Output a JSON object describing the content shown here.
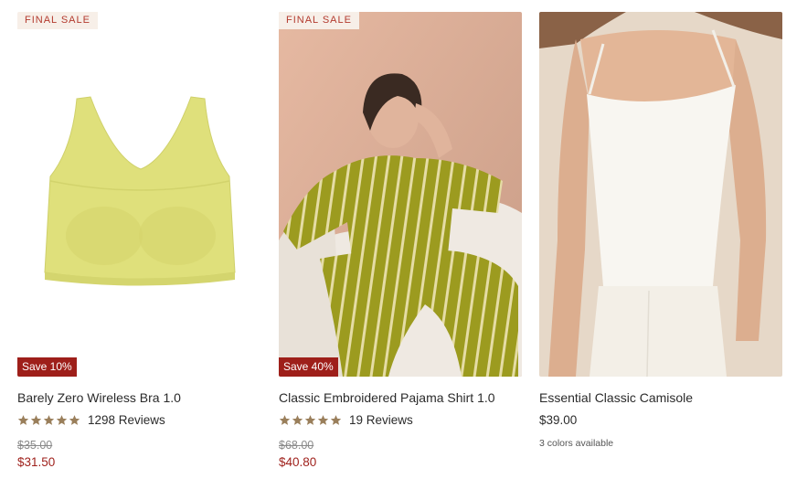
{
  "products": [
    {
      "badge_top": "FINAL SALE",
      "badge_save": "Save 10%",
      "title": "Barely Zero Wireless Bra 1.0",
      "image": "yellow-wireless-bra",
      "rating": 5,
      "reviews": "1298 Reviews",
      "price_old": "$35.00",
      "price_new": "$31.50"
    },
    {
      "badge_top": "FINAL SALE",
      "badge_save": "Save 40%",
      "title": "Classic Embroidered Pajama Shirt 1.0",
      "image": "olive-striped-pajamas",
      "rating": 5,
      "reviews": "19 Reviews",
      "price_old": "$68.00",
      "price_new": "$40.80"
    },
    {
      "title": "Essential Classic Camisole",
      "image": "white-camisole",
      "price": "$39.00",
      "colors": "3 colors available"
    }
  ],
  "colors": {
    "sale_red": "#9e1f1a",
    "badge_bg": "#f7efe8",
    "star": "#9a7f5b"
  }
}
